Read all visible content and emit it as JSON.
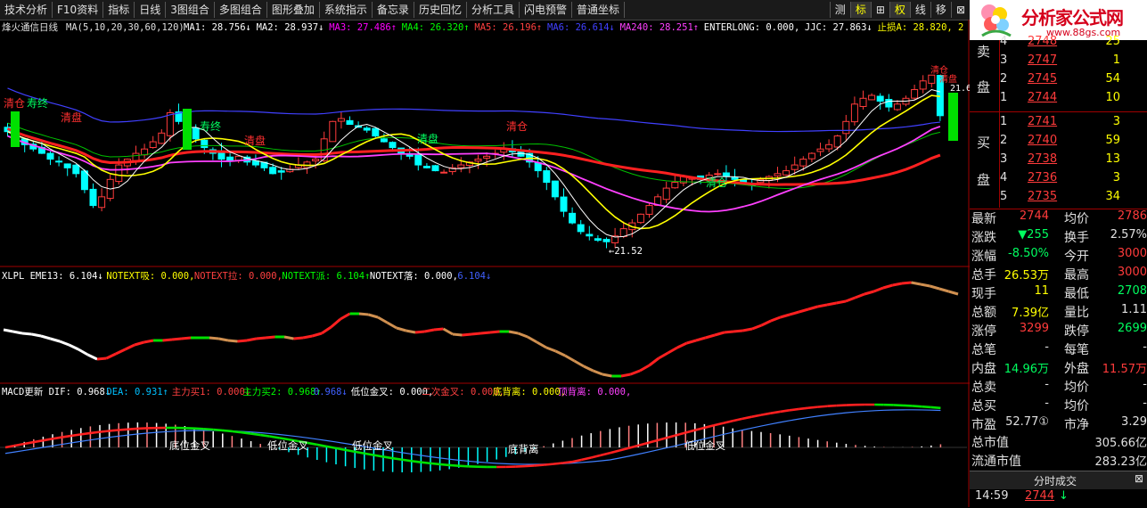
{
  "toolbar": {
    "buttons": [
      "技术分析",
      "F10资料",
      "指标",
      "日线",
      "3图组合",
      "多图组合",
      "图形叠加",
      "系统指示",
      "备忘录",
      "历史回忆",
      "分析工具",
      "闪电预警",
      "普通坐标"
    ],
    "right_buttons": [
      "测",
      "标",
      "⊞",
      "权",
      "线",
      "移",
      "⊠"
    ]
  },
  "logo": {
    "title": "分析家公式网",
    "url": "www.88gs.com"
  },
  "chart_header": {
    "stock_name": "烽火通信",
    "period": "日线",
    "ma_params": "MA(5,10,20,30,60,120)",
    "items": [
      {
        "text": "MA1: 28.756",
        "color": "#ffffff",
        "arrow": "↓"
      },
      {
        "text": "MA2: 28.937",
        "color": "#ffffff",
        "arrow": "↓"
      },
      {
        "text": "MA3: 27.486",
        "color": "#ff00ff",
        "arrow": "↑"
      },
      {
        "text": "MA4: 26.320",
        "color": "#00ff00",
        "arrow": "↑"
      },
      {
        "text": "MA5: 26.196",
        "color": "#ff4040",
        "arrow": "↑"
      },
      {
        "text": "MA6: 26.614",
        "color": "#4040ff",
        "arrow": "↓"
      },
      {
        "text": "MA240: 28.251",
        "color": "#ff40ff",
        "arrow": "↑"
      },
      {
        "text": "ENTERLONG: 0.000,",
        "color": "#ffffff",
        "arrow": ""
      },
      {
        "text": "JJC: 27.863",
        "color": "#ffffff",
        "arrow": "↓"
      },
      {
        "text": "止损A: 28.820, 2",
        "color": "#ffff00",
        "arrow": ""
      }
    ]
  },
  "price_annotations": {
    "low_marker": "←21.52",
    "high_marker": "←",
    "labels": [
      "清仓",
      "寿终",
      "清盘",
      "寿终",
      "清盘",
      "清盘",
      "清仓",
      "清仓"
    ],
    "top_right_labels": [
      "清仓",
      "清盘",
      "21.6"
    ]
  },
  "xlpl_header": [
    {
      "text": "XLPL EME13: 6.104",
      "color": "#ffffff",
      "arrow": "↓"
    },
    {
      "text": "NOTEXT吸: 0.000,",
      "color": "#ffff00",
      "arrow": ""
    },
    {
      "text": "NOTEXT拉: 0.000,",
      "color": "#ff4040",
      "arrow": ""
    },
    {
      "text": "NOTEXT派: 6.104",
      "color": "#00ff00",
      "arrow": "↑"
    },
    {
      "text": "NOTEXT落: 0.000,",
      "color": "#ffffff",
      "arrow": ""
    },
    {
      "text": "6.104",
      "color": "#4060ff",
      "arrow": "↓"
    }
  ],
  "macd_header": [
    {
      "text": "MACD更新 DIF: 0.968",
      "color": "#ffffff",
      "arrow": "↓"
    },
    {
      "text": "DEA: 0.931",
      "color": "#00c0ff",
      "arrow": "↑"
    },
    {
      "text": "主力买1: 0.000",
      "color": "#ff4040",
      "arrow": "↓"
    },
    {
      "text": "主力买2: 0.968",
      "color": "#00ff00",
      "arrow": "↑"
    },
    {
      "text": "0.968",
      "color": "#4060ff",
      "arrow": "↓"
    },
    {
      "text": "低位金叉: 0.000,",
      "color": "#ffffff",
      "arrow": ""
    },
    {
      "text": "二次金叉: 0.000,",
      "color": "#ff4040",
      "arrow": ""
    },
    {
      "text": "底背离: 0.000,",
      "color": "#ffff00",
      "arrow": ""
    },
    {
      "text": "顶背离: 0.000,",
      "color": "#ff40ff",
      "arrow": ""
    }
  ],
  "macd_labels": [
    "底位金叉",
    "低位金叉",
    "低位金叉",
    "底背离",
    "低位金叉"
  ],
  "order_book": {
    "sell_label": [
      "卖",
      "盘"
    ],
    "buy_label": [
      "买",
      "盘"
    ],
    "sell": [
      {
        "level": "4",
        "price": "2748",
        "vol": "25"
      },
      {
        "level": "3",
        "price": "2747",
        "vol": "1"
      },
      {
        "level": "2",
        "price": "2745",
        "vol": "54"
      },
      {
        "level": "1",
        "price": "2744",
        "vol": "10"
      }
    ],
    "buy": [
      {
        "level": "1",
        "price": "2741",
        "vol": "3"
      },
      {
        "level": "2",
        "price": "2740",
        "vol": "59"
      },
      {
        "level": "3",
        "price": "2738",
        "vol": "13"
      },
      {
        "level": "4",
        "price": "2736",
        "vol": "3"
      },
      {
        "level": "5",
        "price": "2735",
        "vol": "34"
      }
    ]
  },
  "quote_rows": [
    {
      "l1": "最新",
      "v1": "2744",
      "c1": "#ff3b3b",
      "l2": "均价",
      "v2": "2786",
      "c2": "#ff3b3b"
    },
    {
      "l1": "涨跌",
      "v1": "▼255",
      "c1": "#00ff60",
      "l2": "换手",
      "v2": "2.57%",
      "c2": "#e0e0e0"
    },
    {
      "l1": "涨幅",
      "v1": "-8.50%",
      "c1": "#00ff60",
      "l2": "今开",
      "v2": "3000",
      "c2": "#ff3b3b"
    },
    {
      "l1": "总手",
      "v1": "26.53万",
      "c1": "#ffff00",
      "l2": "最高",
      "v2": "3000",
      "c2": "#ff3b3b"
    },
    {
      "l1": "现手",
      "v1": "11",
      "c1": "#ffff00",
      "l2": "最低",
      "v2": "2708",
      "c2": "#00ff60"
    },
    {
      "l1": "总额",
      "v1": "7.39亿",
      "c1": "#ffff00",
      "l2": "量比",
      "v2": "1.11",
      "c2": "#e0e0e0"
    },
    {
      "l1": "涨停",
      "v1": "3299",
      "c1": "#ff3b3b",
      "l2": "跌停",
      "v2": "2699",
      "c2": "#00ff60"
    },
    {
      "l1": "总笔",
      "v1": "-",
      "c1": "#e0e0e0",
      "l2": "每笔",
      "v2": "-",
      "c2": "#e0e0e0"
    },
    {
      "l1": "内盘",
      "v1": "14.96万",
      "c1": "#00ff60",
      "l2": "外盘",
      "v2": "11.57万",
      "c2": "#ff3b3b"
    },
    {
      "l1": "总卖",
      "v1": "-",
      "c1": "#e0e0e0",
      "l2": "均价",
      "v2": "-",
      "c2": "#e0e0e0"
    },
    {
      "l1": "总买",
      "v1": "-",
      "c1": "#e0e0e0",
      "l2": "均价",
      "v2": "-",
      "c2": "#e0e0e0"
    },
    {
      "l1": "市盈",
      "v1": "52.77①",
      "c1": "#e0e0e0",
      "l2": "市净",
      "v2": "3.29",
      "c2": "#e0e0e0"
    }
  ],
  "fund_rows": [
    {
      "label": "总市值",
      "value": "305.66亿"
    },
    {
      "label": "流通市值",
      "value": "283.23亿"
    }
  ],
  "bottom": {
    "tab": "分时成交",
    "time": "14:59",
    "price": "2744",
    "arrow": "↓"
  },
  "colors": {
    "up": "#ff3b3b",
    "down": "#00ffff",
    "ma_yellow": "#ffff00",
    "ma_magenta": "#ff40ff"
  }
}
